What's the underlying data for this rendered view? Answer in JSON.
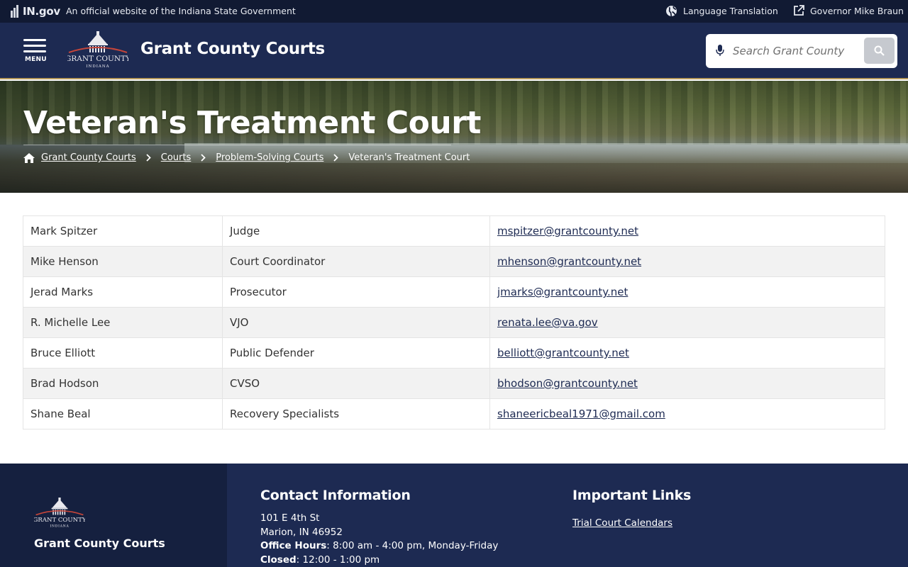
{
  "govbar": {
    "logo_text": "IN.gov",
    "official_text": "An official website of the Indiana State Government",
    "language_label": "Language Translation",
    "governor_label": "Governor Mike Braun"
  },
  "header": {
    "menu_label": "MENU",
    "logo_text": "GRANT COUNTY",
    "logo_subtext": "INDIANA",
    "site_title": "Grant County Courts",
    "search_placeholder": "Search Grant County"
  },
  "hero": {
    "title": "Veteran's Treatment Court",
    "breadcrumb": [
      {
        "label": "Grant County Courts"
      },
      {
        "label": "Courts"
      },
      {
        "label": "Problem-Solving Courts"
      },
      {
        "label": "Veteran's Treatment Court"
      }
    ]
  },
  "contacts": [
    {
      "name": "Mark Spitzer",
      "role": "Judge",
      "email": "mspitzer@grantcounty.net"
    },
    {
      "name": "Mike Henson",
      "role": "Court Coordinator",
      "email": "mhenson@grantcounty.net"
    },
    {
      "name": "Jerad Marks",
      "role": "Prosecutor",
      "email": "jmarks@grantcounty.net"
    },
    {
      "name": "R. Michelle Lee",
      "role": "VJO",
      "email": "renata.lee@va.gov"
    },
    {
      "name": "Bruce Elliott",
      "role": "Public Defender",
      "email": "belliott@grantcounty.net"
    },
    {
      "name": "Brad Hodson",
      "role": "CVSO",
      "email": "bhodson@grantcounty.net"
    },
    {
      "name": "Shane Beal",
      "role": "Recovery Specialists",
      "email": "shaneericbeal1971@gmail.com"
    }
  ],
  "footer": {
    "site_name": "Grant County Courts",
    "logo_text": "GRANT COUNTY",
    "logo_subtext": "INDIANA",
    "contact_heading": "Contact Information",
    "address_line1": "101 E 4th St",
    "address_line2": "Marion, IN 46952",
    "hours_label": "Office Hours",
    "hours_value": ": 8:00 am - 4:00 pm, Monday-Friday",
    "closed_label": "Closed",
    "closed_value": ": 12:00 - 1:00 pm",
    "links_heading": "Important Links",
    "links": [
      "Trial Court Calendars"
    ]
  },
  "colors": {
    "navy": "#1d2a52",
    "gov_bar": "#111a33",
    "gold_rule": "#b89a5a",
    "row_stripe": "#f2f2f2"
  },
  "icons": {
    "language": "globe-icon",
    "governor": "external-link-icon",
    "search": "search-icon",
    "voice": "microphone-icon",
    "home": "home-icon",
    "separator": "chevron-right-icon"
  }
}
